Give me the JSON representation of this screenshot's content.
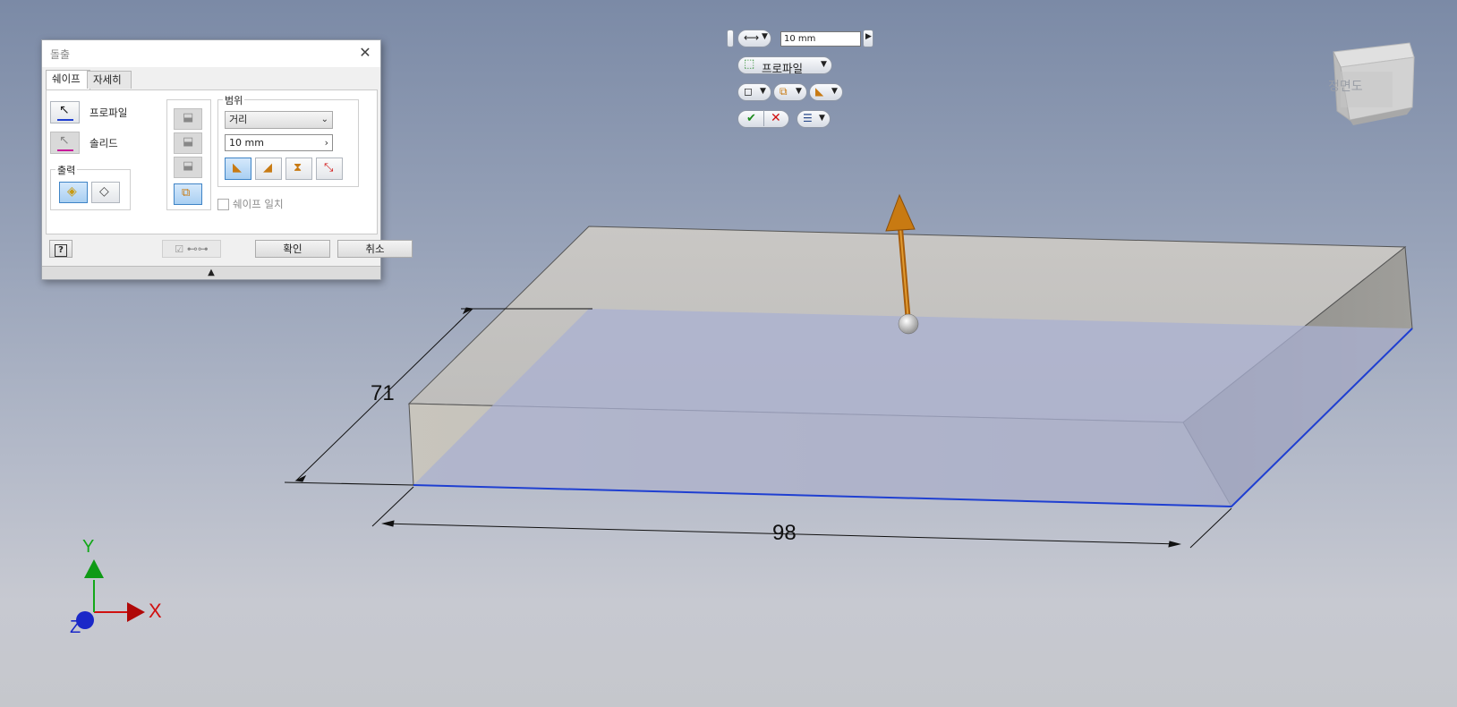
{
  "dialog": {
    "title": "돌출",
    "tabs": [
      "쉐이프",
      "자세히"
    ],
    "profile_label": "프로파일",
    "solid_label": "솔리드",
    "output_group": "출력",
    "extents_group": "범위",
    "extents_type": "거리",
    "distance_value": "10 mm",
    "match_shape_label": "쉐이프 일치",
    "ok_label": "확인",
    "cancel_label": "취소",
    "help_icon_text": "?"
  },
  "mini_toolbar": {
    "distance_value": "10 mm",
    "profile_label": "프로파일"
  },
  "viewcube": {
    "face_label": "정면도"
  },
  "dimensions": {
    "depth": "71",
    "width": "98"
  },
  "axes": {
    "x": "X",
    "y": "Y",
    "z": "Z"
  },
  "colors": {
    "selected_edge": "#1f3fd1",
    "arrow": "#c87a12",
    "axis_x": "#d01010",
    "axis_y": "#12a818",
    "axis_z": "#1a28c8"
  }
}
